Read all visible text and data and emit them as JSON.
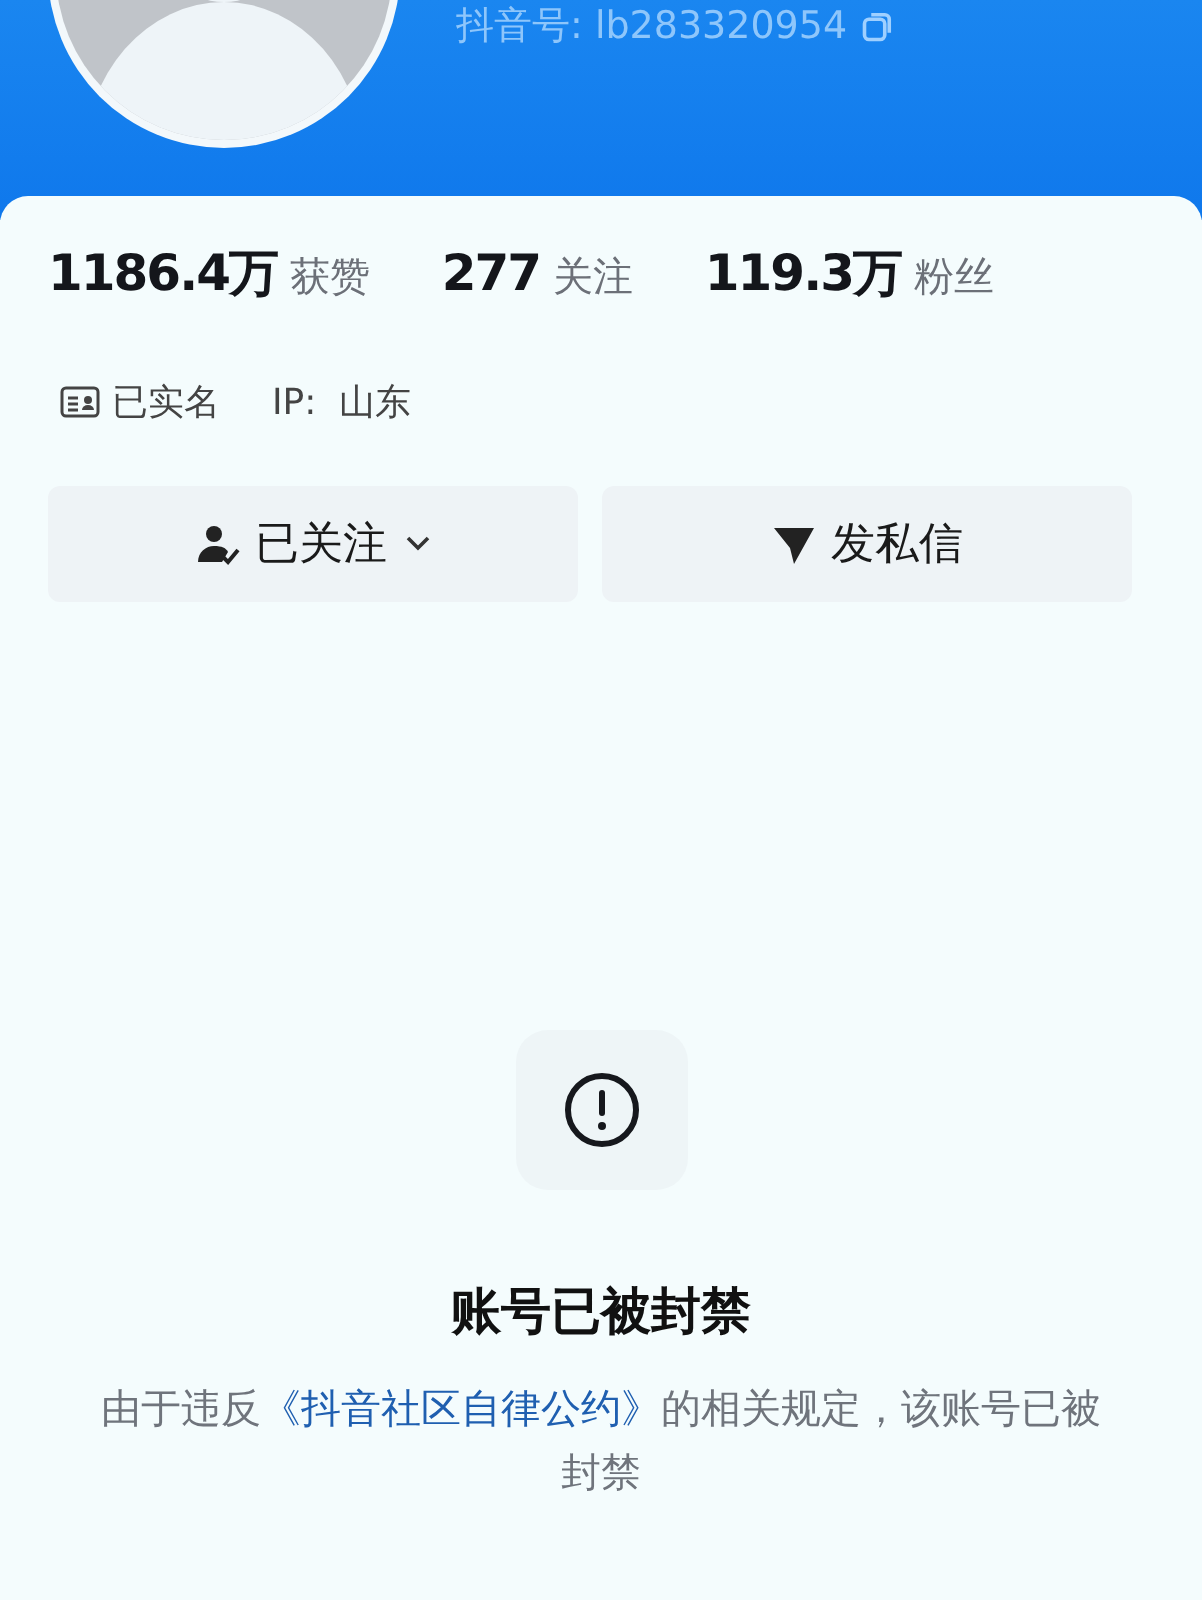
{
  "profile": {
    "douyin_id_label": "抖音号:",
    "douyin_id": "lb283320954"
  },
  "stats": [
    "**1186.4万** 获赞",
    "**277** 关注",
    "**119.3万** 粉丝"
  ],
  "tags": [
    {
      "kind": "verified",
      "text": "已实名"
    },
    {
      "kind": "ip",
      "text": "IP:  山东"
    }
  ],
  "actions": [
    {
      "kind": "follow",
      "label": "已关注"
    },
    {
      "kind": "message",
      "label": "发私信"
    }
  ],
  "notice": {
    "title": "账号已被封禁",
    "text_before": "由于违反",
    "link": "《抖音社区自律公约》",
    "text_after": "的相关规定，该账号已被封禁"
  }
}
